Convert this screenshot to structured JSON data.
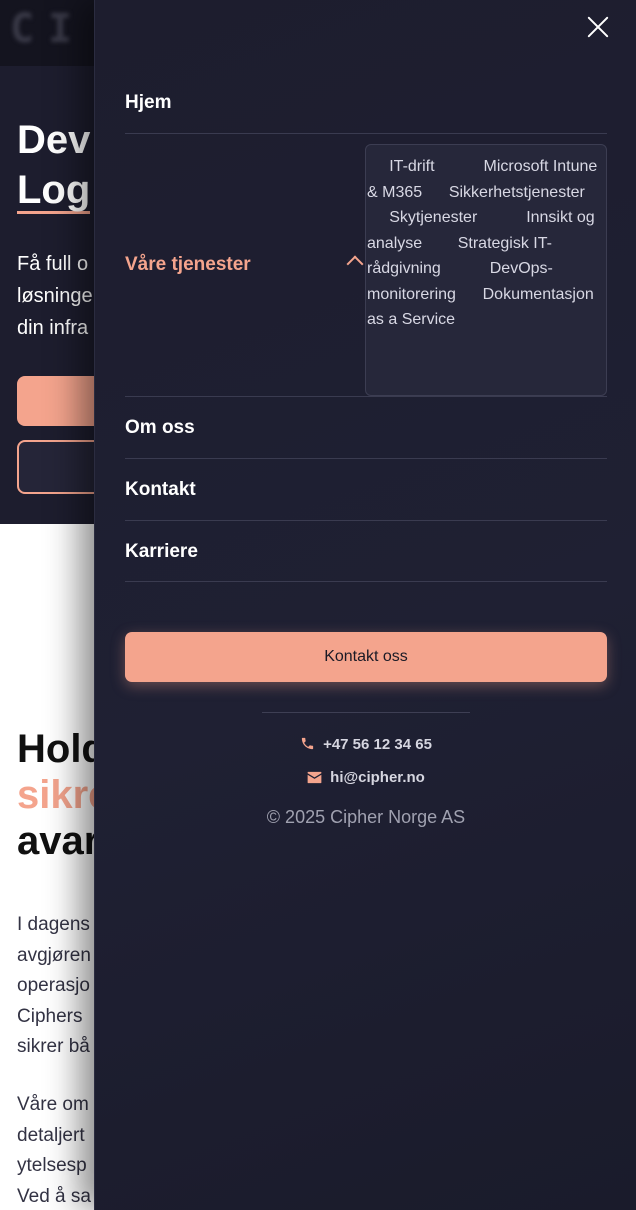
{
  "background": {
    "logo_text": "CI",
    "hero_title_line1": "Dev",
    "hero_title_line2": "Log",
    "hero_subtitle": "Få full o\nløsninge\ndin infra",
    "section_title_line1": "Hold",
    "section_title_line2": "sikre",
    "section_title_line3": "avar",
    "body_paragraph1": "I dagens\navgjøren\noperasjo\nCiphers \nsikrer bå",
    "body_paragraph2": "Våre om\ndetaljert\nytelsesp\nVed å sa"
  },
  "menu": {
    "items": [
      {
        "label": "Hjem"
      },
      {
        "label": "Våre tjenester",
        "expanded": true
      },
      {
        "label": "Om oss"
      },
      {
        "label": "Kontakt"
      },
      {
        "label": "Karriere"
      }
    ],
    "services": [
      "IT-drift",
      "Microsoft Intune & M365",
      "Sikkerhetstjenester",
      "Skytjenester",
      "Innsikt og analyse",
      "Strategisk IT-rådgivning",
      "DevOps-monitorering",
      "Dokumentasjon as a Service"
    ],
    "cta_label": "Kontakt oss",
    "phone": "+47 56 12 34 65",
    "email": "hi@cipher.no",
    "copyright": "© 2025 Cipher Norge AS",
    "icons": {
      "close": "close-icon",
      "chevron": "chevron-up-icon",
      "phone": "phone-icon",
      "email": "mail-icon"
    }
  },
  "colors": {
    "accent": "#f4a48d",
    "drawer_bg": "#1d1d2e",
    "text": "#ffffff"
  }
}
